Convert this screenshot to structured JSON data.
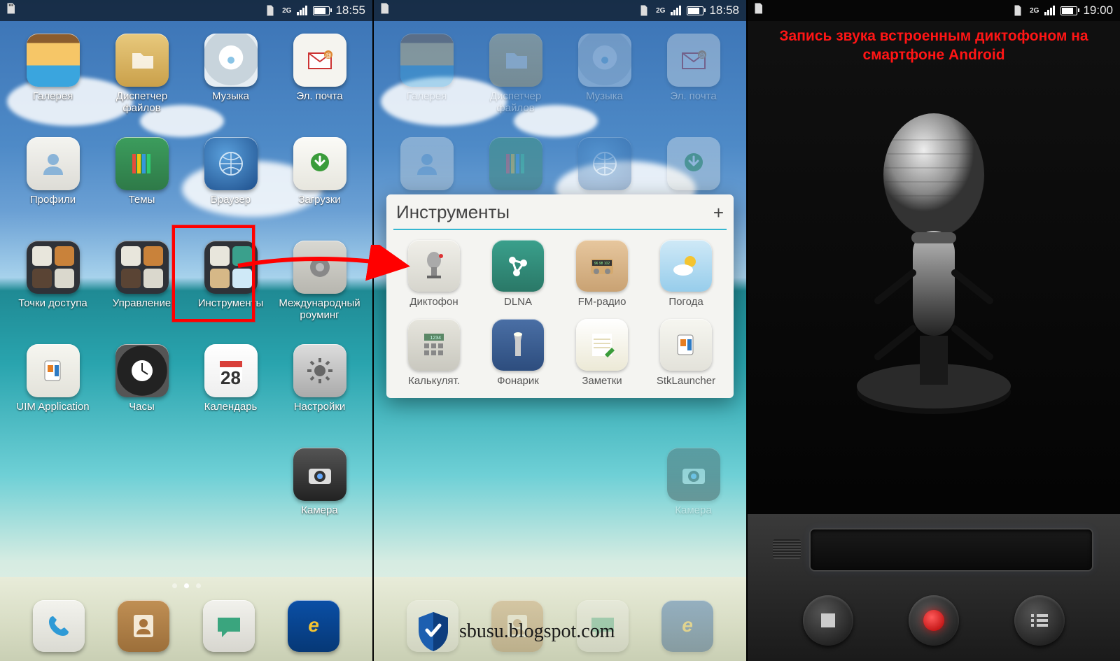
{
  "status": {
    "network": "2G",
    "times": [
      "18:55",
      "18:58",
      "19:00"
    ]
  },
  "s1": {
    "apps": [
      {
        "label": "Галерея",
        "icon": "gallery-icon",
        "cls": "bg-photo"
      },
      {
        "label": "Диспетчер файлов",
        "icon": "files-icon",
        "cls": "bg-folder"
      },
      {
        "label": "Музыка",
        "icon": "music-icon",
        "cls": "bg-disc"
      },
      {
        "label": "Эл. почта",
        "icon": "email-icon",
        "cls": "bg-mail"
      },
      {
        "label": "Профили",
        "icon": "profiles-icon",
        "cls": "bg-person"
      },
      {
        "label": "Темы",
        "icon": "themes-icon",
        "cls": "bg-pencils"
      },
      {
        "label": "Браузер",
        "icon": "browser-icon",
        "cls": "bg-globe"
      },
      {
        "label": "Загрузки",
        "icon": "downloads-icon",
        "cls": "bg-dl"
      },
      {
        "label": "Точки доступа",
        "icon": "hotspot-icon",
        "cls": "bg-tiles"
      },
      {
        "label": "Управление",
        "icon": "management-icon",
        "cls": "bg-tiles2"
      },
      {
        "label": "Инструменты",
        "icon": "tools-folder-icon",
        "cls": "bg-tiles",
        "highlight": true
      },
      {
        "label": "Международный роуминг",
        "icon": "roaming-icon",
        "cls": "bg-roam"
      },
      {
        "label": "UIM Application",
        "icon": "uim-icon",
        "cls": "bg-sim"
      },
      {
        "label": "Часы",
        "icon": "clock-icon",
        "cls": "bg-clock"
      },
      {
        "label": "Календарь",
        "icon": "calendar-icon",
        "cls": "bg-cal",
        "badge": "28"
      },
      {
        "label": "Настройки",
        "icon": "settings-icon",
        "cls": "bg-gear"
      },
      {
        "label": "",
        "icon": "",
        "cls": "",
        "empty": true
      },
      {
        "label": "",
        "icon": "",
        "cls": "",
        "empty": true
      },
      {
        "label": "",
        "icon": "",
        "cls": "",
        "empty": true
      },
      {
        "label": "Камера",
        "icon": "camera-icon",
        "cls": "bg-cam"
      }
    ],
    "dock": [
      {
        "icon": "phone-icon",
        "cls": "bg-phone"
      },
      {
        "icon": "contacts-icon",
        "cls": "bg-cont"
      },
      {
        "icon": "messages-icon",
        "cls": "bg-msg"
      },
      {
        "icon": "internet-icon",
        "cls": "bg-net"
      }
    ]
  },
  "s2": {
    "folder_title": "Инструменты",
    "apps": [
      {
        "label": "Диктофон",
        "icon": "recorder-icon",
        "cls": "bg-mic"
      },
      {
        "label": "DLNA",
        "icon": "dlna-icon",
        "cls": "bg-dlna"
      },
      {
        "label": "FM-радио",
        "icon": "fmradio-icon",
        "cls": "bg-radio"
      },
      {
        "label": "Погода",
        "icon": "weather-icon",
        "cls": "bg-weather"
      },
      {
        "label": "Калькулят.",
        "icon": "calculator-icon",
        "cls": "bg-calc"
      },
      {
        "label": "Фонарик",
        "icon": "flashlight-icon",
        "cls": "bg-torch"
      },
      {
        "label": "Заметки",
        "icon": "notes-icon",
        "cls": "bg-notes"
      },
      {
        "label": "StkLauncher",
        "icon": "stklauncher-icon",
        "cls": "bg-sim"
      }
    ],
    "dim_camera": "Камера"
  },
  "s3": {
    "title": "Запись звука встроенным диктофоном на смартфоне Android"
  },
  "watermark": "sbusu.blogspot.com"
}
